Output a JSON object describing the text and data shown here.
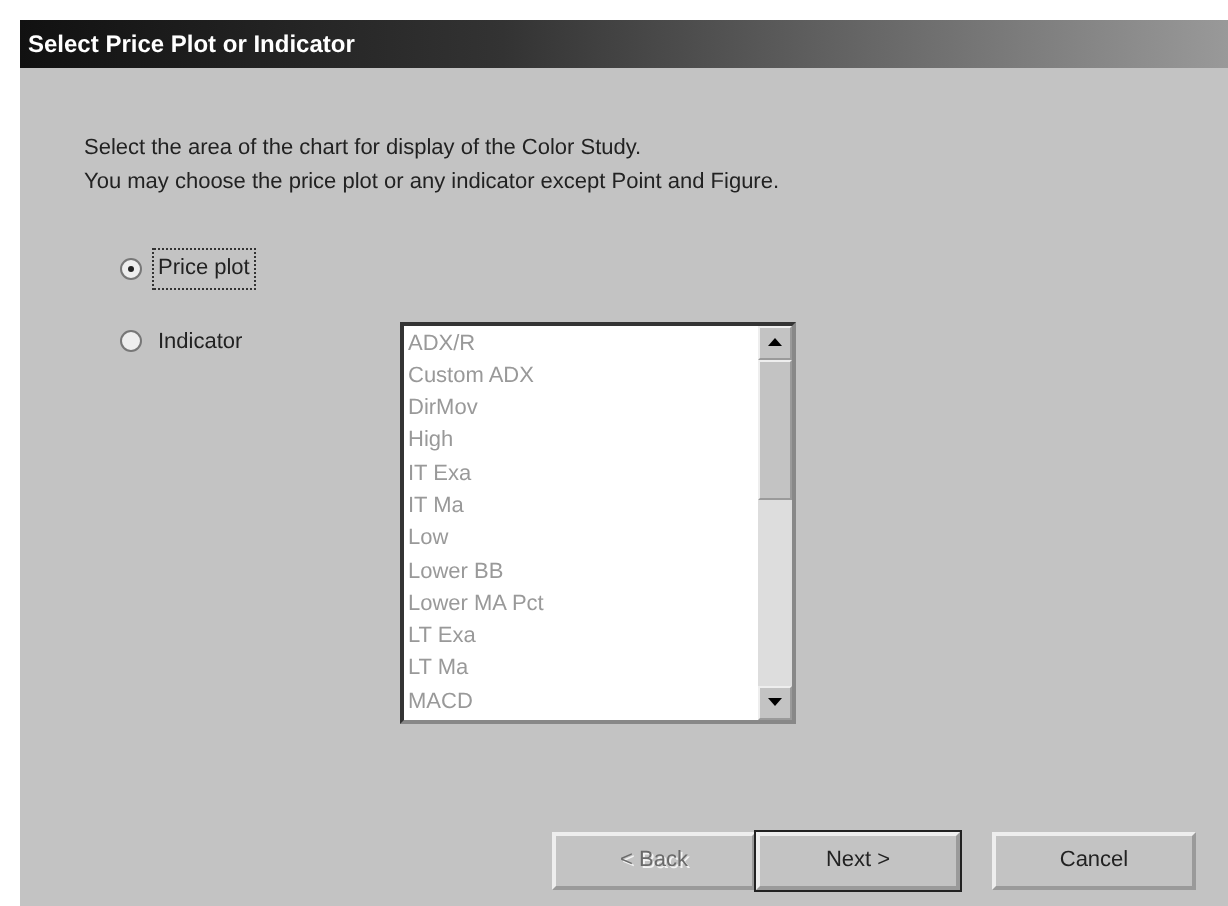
{
  "window": {
    "title": "Select Price Plot or Indicator"
  },
  "instructions": [
    "Select the area of the chart for display of the Color Study.",
    "You may choose the price plot or any indicator except Point and Figure."
  ],
  "options": [
    {
      "label": "Price plot",
      "selected": true
    },
    {
      "label": "Indicator",
      "selected": false
    }
  ],
  "indicator_list": {
    "disabled": true,
    "items": [
      "ADX/R",
      "Custom ADX",
      "DirMov",
      "High",
      "IT Exa",
      "IT Ma",
      "Low",
      "Lower BB",
      "Lower MA Pct",
      "LT Exa",
      "LT Ma",
      "MACD"
    ]
  },
  "buttons": [
    {
      "label": "< Back",
      "disabled": true,
      "default": false
    },
    {
      "label": "Next >",
      "disabled": false,
      "default": true
    },
    {
      "label": "Cancel",
      "disabled": false,
      "default": false
    }
  ]
}
